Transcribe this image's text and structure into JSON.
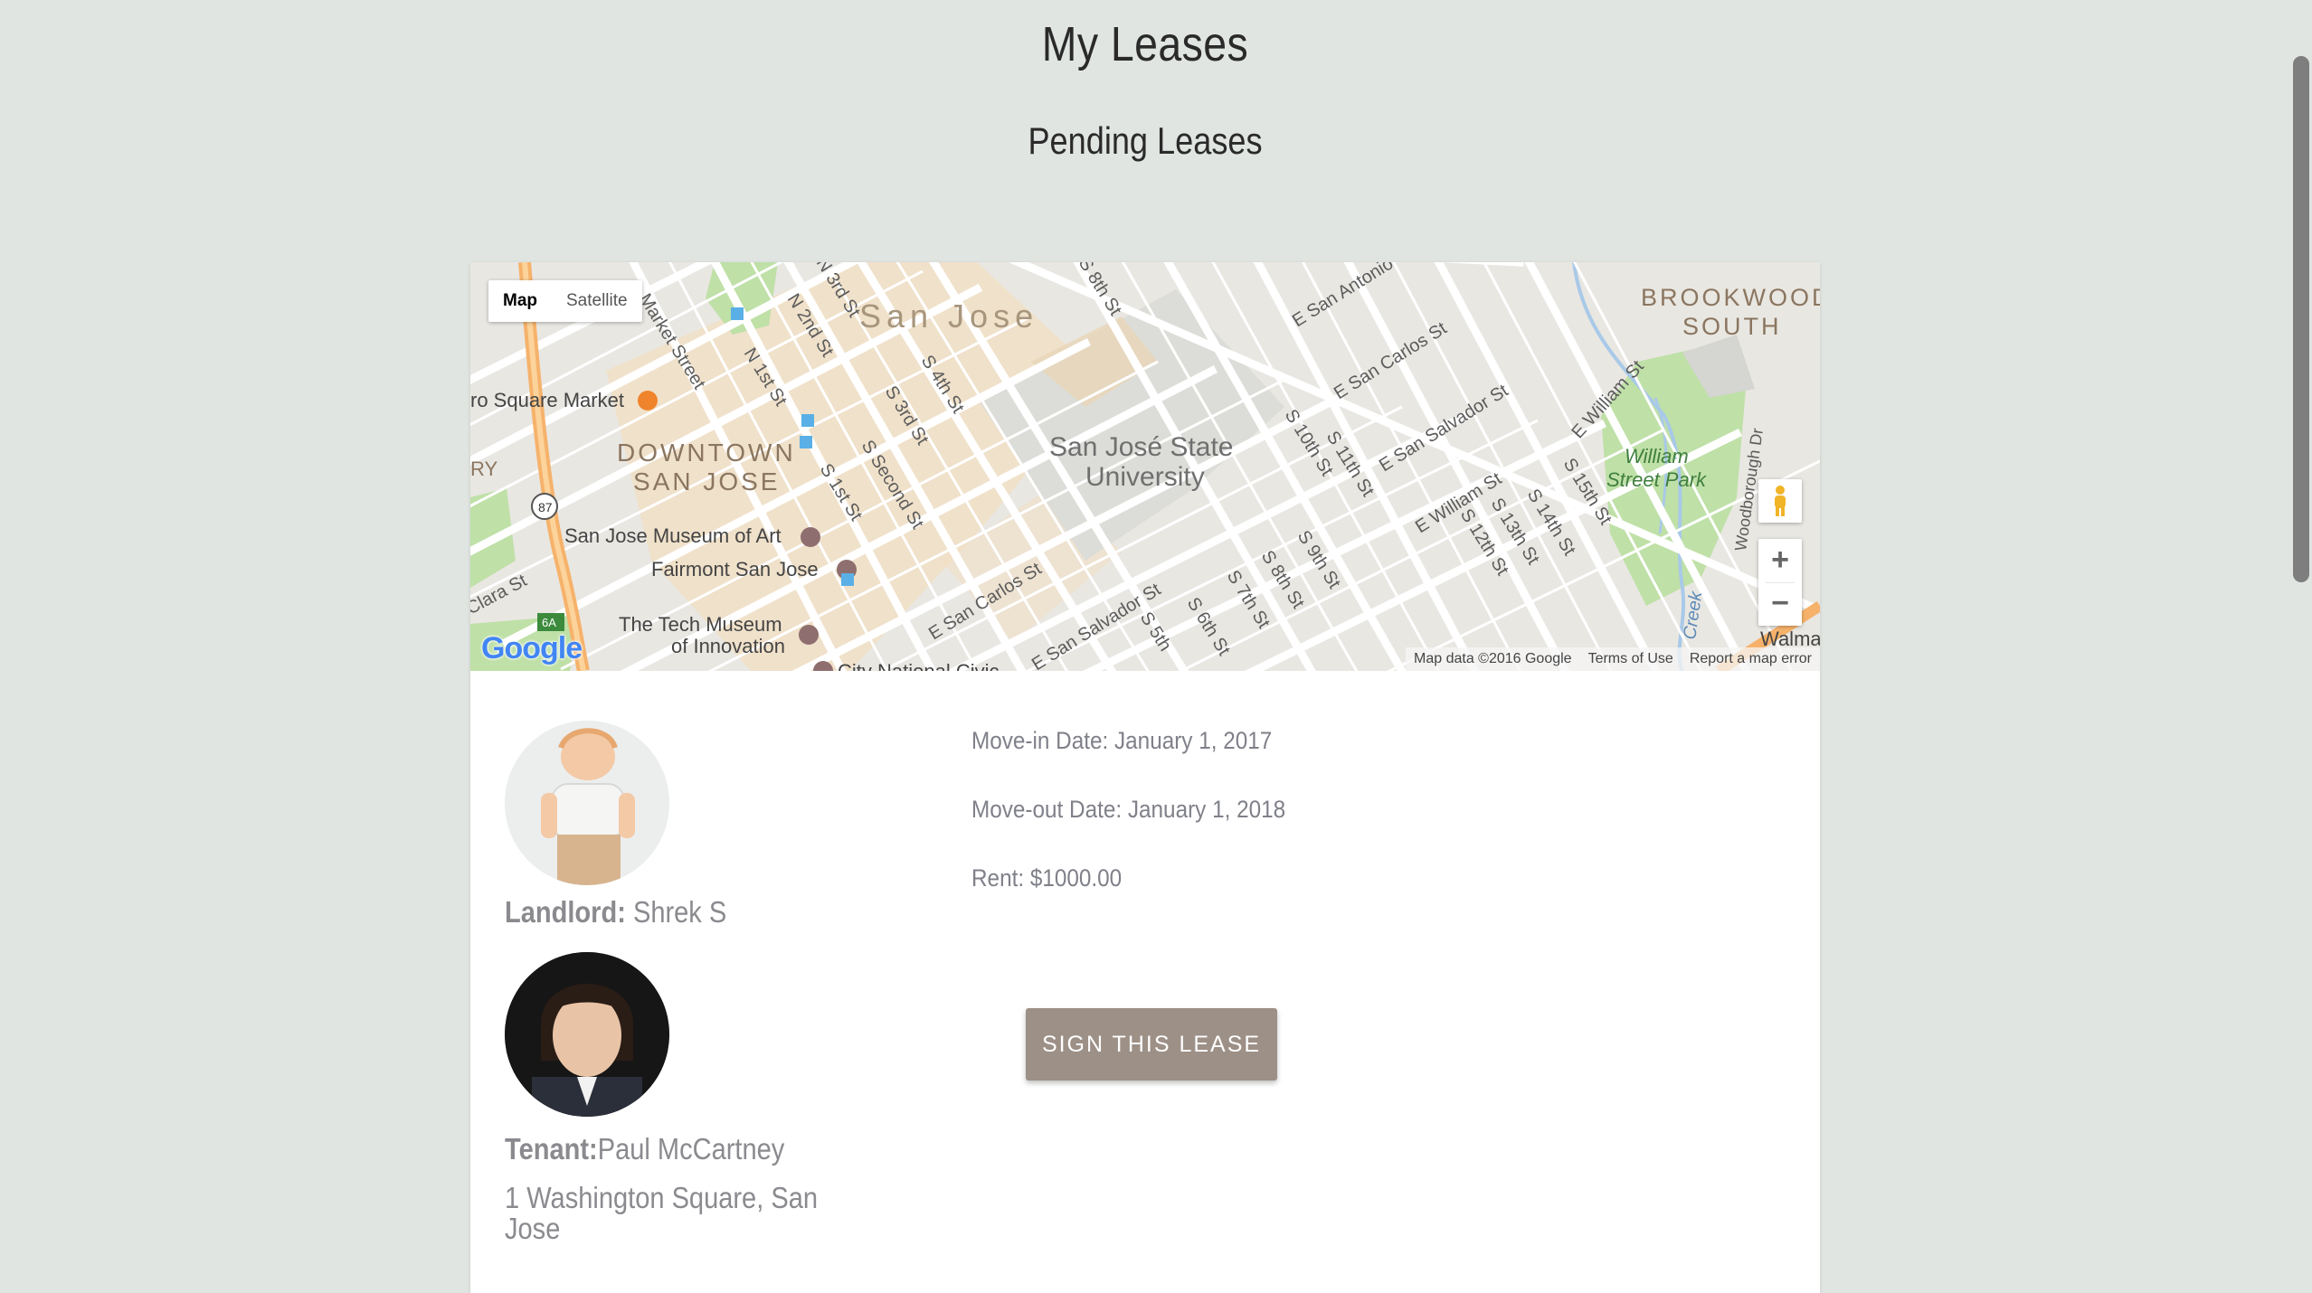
{
  "page": {
    "title": "My Leases",
    "section_title": "Pending Leases"
  },
  "map": {
    "type_control": {
      "map_label": "Map",
      "satellite_label": "Satellite"
    },
    "zoom_in_label": "+",
    "zoom_out_label": "−",
    "logo_text": "Google",
    "footer": {
      "map_data": "Map data ©2016 Google",
      "terms": "Terms of Use",
      "report": "Report a map error"
    },
    "labels": {
      "city": "San Jose",
      "downtown_1": "DOWNTOWN",
      "downtown_2": "SAN JOSE",
      "university_1": "San José State",
      "university_2": "University",
      "brookwood_1": "BROOKWOOD",
      "brookwood_2": "SOUTH",
      "park_1": "William",
      "park_2": "Street Park",
      "market": "ro Square Market",
      "museum_art": "San Jose Museum of Art",
      "fairmont": "Fairmont San Jose",
      "tech_1": "The Tech Museum",
      "tech_2": "of Innovation",
      "civic": "City National Civic",
      "walmart": "Walma",
      "market_st": "Market Street",
      "n1st": "N 1st St",
      "n2nd": "N 2nd St",
      "n3rd": "N 3rd St",
      "s1st": "S 1st St",
      "s2nd": "S Second St",
      "s3rd": "S 3rd St",
      "s4th": "S 4th St",
      "s5th": "S 5th",
      "s6th": "S 6th St",
      "s7th": "S 7th St",
      "s8th_top": "S 8th St",
      "s8th": "S 8th St",
      "s9th": "S 9th St",
      "s10th": "S 10th St",
      "s11th": "S 11th St",
      "s12th": "S 12th St",
      "s13th": "S 13th St",
      "s14th": "S 14th St",
      "s15th": "S 15th St",
      "e_san_antonio": "E San Antonio",
      "e_san_carlos_1": "E San Carlos St",
      "e_san_carlos_2": "E San Carlos St",
      "e_san_salvador_1": "E San Salvador St",
      "e_san_salvador_2": "E San Salvador St",
      "e_william_1": "E William St",
      "e_william_2": "E William St",
      "woodborough": "Woodborough Dr",
      "creek": "Creek",
      "clara": "Clara St",
      "ry": "RY",
      "hwy87": "87",
      "exit6a": "6A"
    }
  },
  "lease": {
    "landlord_label": "Landlord:",
    "landlord_name": " Shrek S",
    "tenant_label": "Tenant:",
    "tenant_name": "Paul McCartney",
    "address": "1 Washington Square, San Jose",
    "move_in": "Move-in Date: January 1, 2017",
    "move_out": "Move-out Date: January 1, 2018",
    "rent": "Rent: $1000.00",
    "sign_button": "SIGN THIS LEASE"
  },
  "colors": {
    "background": "#e1e5e2",
    "card": "#ffffff",
    "button": "#9d9087",
    "muted_text": "#8a8a8f"
  }
}
